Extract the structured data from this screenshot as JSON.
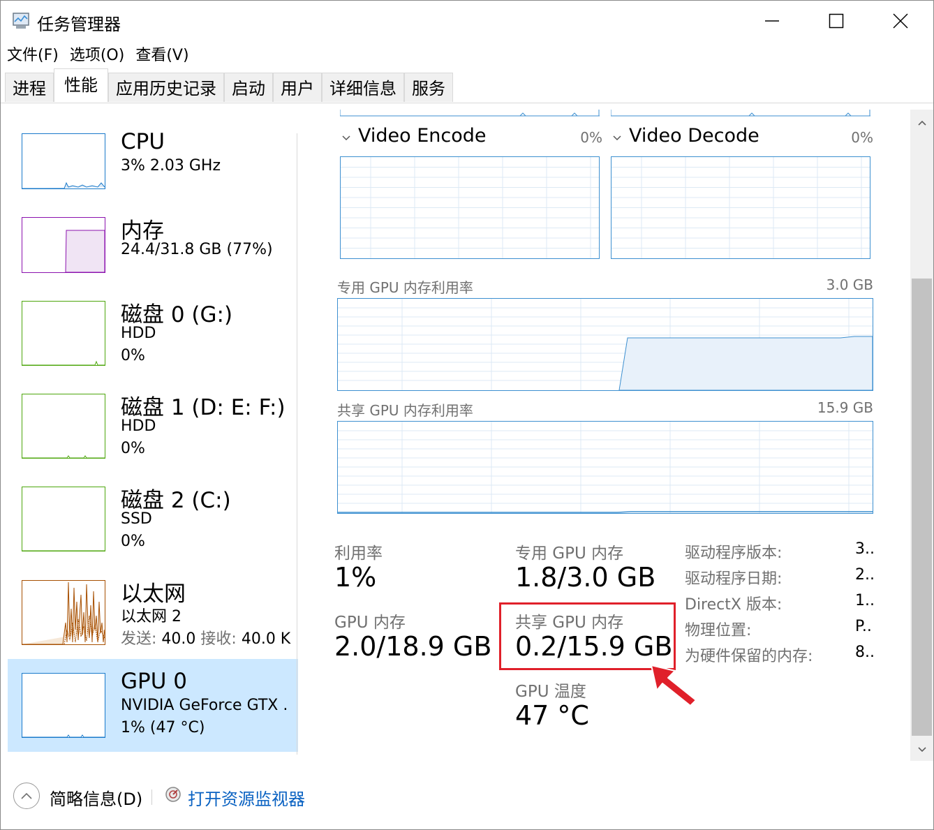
{
  "window": {
    "title": "任务管理器",
    "controls": {
      "minimize": "minimize",
      "maximize": "maximize",
      "close": "close"
    }
  },
  "menu": [
    "文件(F)",
    "选项(O)",
    "查看(V)"
  ],
  "tabs": [
    "进程",
    "性能",
    "应用历史记录",
    "启动",
    "用户",
    "详细信息",
    "服务"
  ],
  "active_tab": "性能",
  "resources": [
    {
      "name": "CPU",
      "sub1": "3%  2.03 GHz",
      "sub2": "",
      "color": "#1979ca"
    },
    {
      "name": "内存",
      "sub1": "24.4/31.8 GB (77%)",
      "sub2": "",
      "color": "#8b12ae",
      "fill_fraction": 0.77
    },
    {
      "name": "磁盘 0 (G:)",
      "sub1": "HDD",
      "sub2": "0%",
      "color": "#4da60c"
    },
    {
      "name": "磁盘 1 (D: E: F:)",
      "sub1": "HDD",
      "sub2": "0%",
      "color": "#4da60c"
    },
    {
      "name": "磁盘 2 (C:)",
      "sub1": "SSD",
      "sub2": "0%",
      "color": "#4da60c"
    },
    {
      "name": "以太网",
      "sub1": "以太网 2",
      "sub2_label_send": "发送:",
      "sub2_send": "40.0",
      "sub2_label_recv": "接收:",
      "sub2_recv": "40.0 K",
      "color": "#a74f01"
    },
    {
      "name": "GPU 0",
      "sub1": "NVIDIA GeForce GTX .",
      "sub2": "1% (47 °C)",
      "color": "#1979ca",
      "selected": true
    }
  ],
  "gpu_panel": {
    "engines": [
      {
        "name": "Video Encode",
        "percent": "0%"
      },
      {
        "name": "Video Decode",
        "percent": "0%"
      }
    ],
    "dedicated_graph": {
      "label": "专用 GPU 内存利用率",
      "max": "3.0 GB",
      "usage_fraction": 0.6
    },
    "shared_graph": {
      "label": "共享 GPU 内存利用率",
      "max": "15.9 GB",
      "usage_fraction": 0.013
    },
    "stats": {
      "utilization": {
        "label": "利用率",
        "value": "1%"
      },
      "dedicated_mem": {
        "label": "专用 GPU 内存",
        "value": "1.8/3.0 GB"
      },
      "gpu_mem": {
        "label": "GPU 内存",
        "value": "2.0/18.9 GB"
      },
      "shared_mem": {
        "label": "共享 GPU 内存",
        "value": "0.2/15.9 GB"
      },
      "temperature": {
        "label": "GPU 温度",
        "value": "47 °C"
      }
    },
    "info": [
      {
        "label": "驱动程序版本:",
        "value": "3.."
      },
      {
        "label": "驱动程序日期:",
        "value": "2.."
      },
      {
        "label": "DirectX 版本:",
        "value": "1.."
      },
      {
        "label": "物理位置:",
        "value": "P.."
      },
      {
        "label": "为硬件保留的内存:",
        "value": "8.."
      }
    ]
  },
  "annotation": {
    "highlight_color": "#e0202a",
    "arrow_color": "#e0202a"
  },
  "footer": {
    "summary_label": "简略信息(D)",
    "monitor_link": "打开资源监视器"
  }
}
